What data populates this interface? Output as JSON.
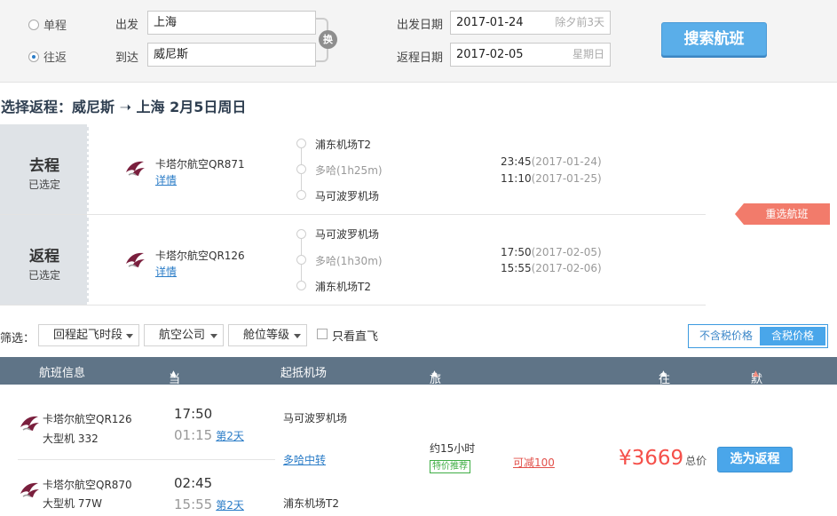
{
  "search": {
    "trip_types": [
      {
        "label": "单程",
        "checked": false
      },
      {
        "label": "往返",
        "checked": true
      }
    ],
    "from_label": "出发",
    "from_value": "上海",
    "to_label": "到达",
    "to_value": "威尼斯",
    "swap_label": "换",
    "depart_date_label": "出发日期",
    "depart_date": "2017-01-24",
    "depart_hint": "除夕前3天",
    "return_date_label": "返程日期",
    "return_date": "2017-02-05",
    "return_hint": "星期日",
    "search_button": "搜索航班"
  },
  "heading": "选择返程：威尼斯 ➝ 上海  2月5日周日",
  "legs": [
    {
      "tag": "去程",
      "status": "已选定",
      "airline": "卡塔尔航空QR871",
      "detail": "详情",
      "stops": [
        "浦东机场T2",
        "多哈(1h25m)",
        "马可波罗机场"
      ],
      "depart_time": "23:45",
      "depart_date": "(2017-01-24)",
      "arrive_time": "11:10",
      "arrive_date": "(2017-01-25)"
    },
    {
      "tag": "返程",
      "status": "已选定",
      "airline": "卡塔尔航空QR126",
      "detail": "详情",
      "stops": [
        "马可波罗机场",
        "多哈(1h30m)",
        "浦东机场T2"
      ],
      "depart_time": "17:50",
      "depart_date": "(2017-02-05)",
      "arrive_time": "15:55",
      "arrive_date": "(2017-02-06)"
    }
  ],
  "reselect_label": "重选航班",
  "filters": {
    "label": "筛选：",
    "dropdowns": [
      "回程起飞时段",
      "航空公司",
      "舱位等级"
    ],
    "direct_only": "只看直飞",
    "price_options": [
      "不含税价格",
      "含税价格"
    ]
  },
  "columns": {
    "info": "航班信息",
    "times": "当地起降时间",
    "airport": "起抵机场",
    "duration": "旅行总时长",
    "price": "往返 价格",
    "sort": "默认排序"
  },
  "result": {
    "segments": [
      {
        "airline": "卡塔尔航空QR126",
        "plane": "大型机 332",
        "depart": "17:50",
        "arrive": "01:15",
        "plus_day": "第2天",
        "airport": "马可波罗机场"
      },
      {
        "airline": "卡塔尔航空QR870",
        "plane": "大型机 77W",
        "depart": "02:45",
        "arrive": "15:55",
        "plus_day": "第2天",
        "airport": "浦东机场T2"
      }
    ],
    "transfer": "多哈中转",
    "duration": "约15小时",
    "badge": "特价推荐",
    "discount": "可减100",
    "price": "¥3669",
    "price_unit": "总价",
    "select_button": "选为返程"
  },
  "colors": {
    "accent_blue": "#4aa6ea",
    "header_bar": "#5f7487",
    "price_red": "#f5504a",
    "reselect_red": "#f27b6b",
    "badge_green": "#3fae45"
  }
}
